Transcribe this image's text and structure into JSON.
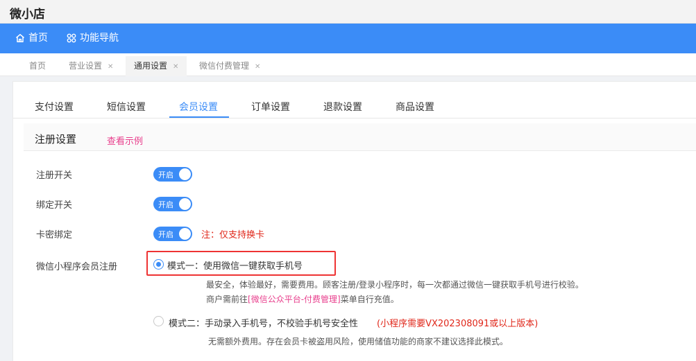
{
  "app": {
    "title": "微小店"
  },
  "topnav": [
    {
      "label": "首页",
      "icon": "home-icon"
    },
    {
      "label": "功能导航",
      "icon": "grid-icon"
    }
  ],
  "tabs": [
    {
      "label": "首页",
      "closable": false,
      "active": false
    },
    {
      "label": "营业设置",
      "closable": true,
      "active": false
    },
    {
      "label": "通用设置",
      "closable": true,
      "active": true
    },
    {
      "label": "微信付费管理",
      "closable": true,
      "active": false
    }
  ],
  "subtabs": [
    "支付设置",
    "短信设置",
    "会员设置",
    "订单设置",
    "退款设置",
    "商品设置"
  ],
  "active_subtab": "会员设置",
  "section": {
    "title": "注册设置",
    "example_link": "查看示例"
  },
  "settings": [
    {
      "label": "注册开关",
      "switch_text": "开启",
      "on": true
    },
    {
      "label": "绑定开关",
      "switch_text": "开启",
      "on": true
    },
    {
      "label": "卡密绑定",
      "switch_text": "开启",
      "on": true,
      "note": "注：仅支持换卡"
    }
  ],
  "wechat_register": {
    "label": "微信小程序会员注册",
    "mode1": {
      "label": "模式一：使用微信一键获取手机号",
      "selected": true,
      "desc1": "最安全，体验最好，需要费用。顾客注册/登录小程序时，每一次都通过微信一键获取手机号进行校验。",
      "desc2_prefix": "商户需前往",
      "desc2_link": "[微信公众平台-付费管理]",
      "desc2_suffix": "菜单自行充值。"
    },
    "mode2": {
      "label": "模式二：手动录入手机号，不校验手机号安全性",
      "warning": "(小程序需要VX202308091或以上版本)",
      "selected": false,
      "desc": "无需额外费用。存在会员卡被盗用风险，使用储值功能的商家不建议选择此模式。"
    }
  },
  "colors": {
    "primary": "#3b8cf7",
    "danger": "#e0271a",
    "link": "#e83e8c"
  }
}
